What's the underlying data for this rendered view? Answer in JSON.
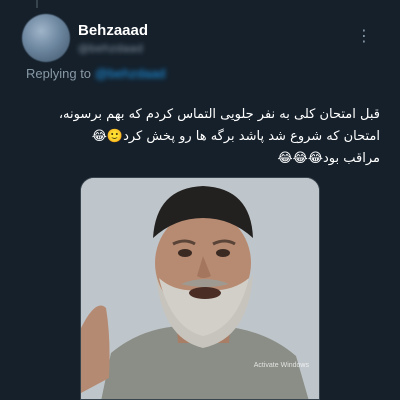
{
  "author": {
    "display_name": "Behzaaad",
    "handle": "@behzdaad"
  },
  "reply": {
    "prefix": "Replying to",
    "mention": "@behzdaad"
  },
  "tweet": {
    "lines": [
      "قبل امتحان کلی به نفر جلویی التماس کردم که بهم برسونه،",
      "امتحان که شروع شد پاشد برگه ها رو پخش کرد🙂😂",
      "مراقب بود😂😂😂"
    ]
  },
  "media": {
    "watermark": "Activate Windows"
  },
  "icons": {
    "more": "more-horizontal-icon"
  },
  "colors": {
    "background": "#15202b",
    "accent": "#1d9bf0",
    "secondary_text": "#8899a6"
  }
}
